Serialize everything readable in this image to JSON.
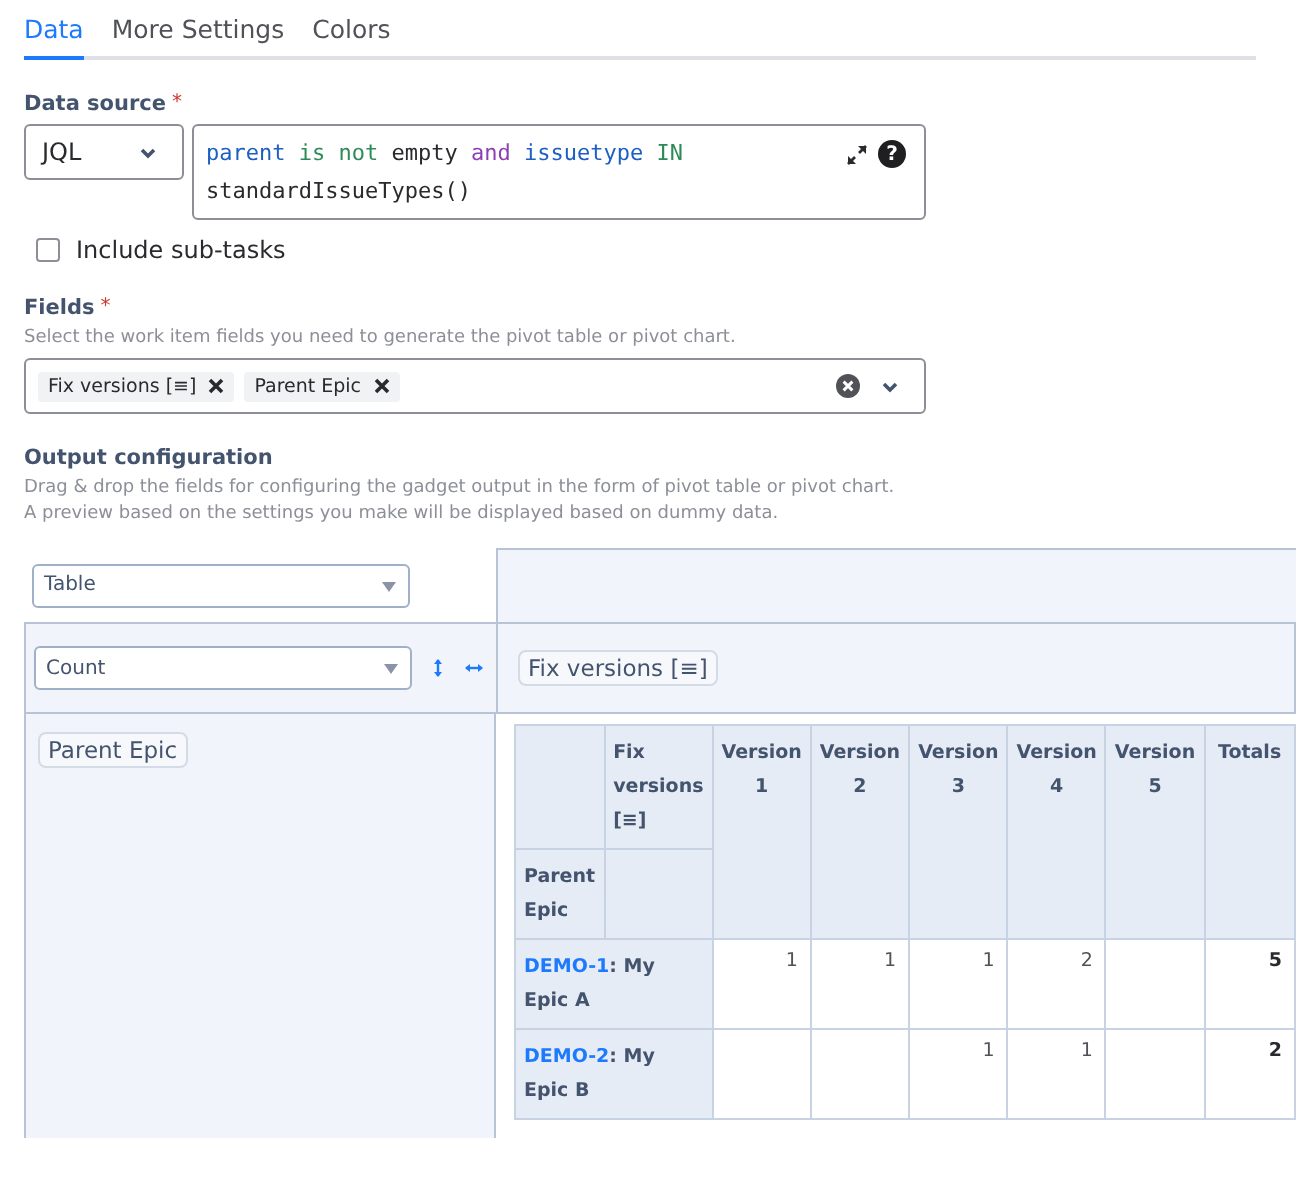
{
  "tabs": [
    {
      "label": "Data",
      "selected": true
    },
    {
      "label": "More Settings",
      "selected": false
    },
    {
      "label": "Colors",
      "selected": false
    }
  ],
  "data_source": {
    "label": "Data source",
    "required_mark": "*",
    "type_select": "JQL",
    "help_icon": "?",
    "query": [
      {
        "text": "parent",
        "kind": "field"
      },
      {
        "text": "is not",
        "kind": "operator"
      },
      {
        "text": "empty",
        "kind": "plain"
      },
      {
        "text": "and",
        "kind": "keyword"
      },
      {
        "text": "issuetype",
        "kind": "field"
      },
      {
        "text": "IN",
        "kind": "operator"
      },
      {
        "text": "standardIssueTypes()",
        "kind": "plain"
      }
    ]
  },
  "include_subtasks": {
    "label": "Include sub-tasks",
    "checked": false
  },
  "fields": {
    "label": "Fields",
    "required_mark": "*",
    "help": "Select the work item fields you need to generate the pivot table or pivot chart.",
    "chips": [
      "Fix versions [≡]",
      "Parent Epic"
    ]
  },
  "output": {
    "label": "Output configuration",
    "help": [
      "Drag & drop the fields for configuring the gadget output in the form of pivot table or pivot chart.",
      "A preview based on the settings you make will be displayed based on dummy data."
    ],
    "view_select": "Table",
    "aggregate_select": "Count",
    "column_field": "Fix versions [≡]",
    "row_field": "Parent Epic",
    "table": {
      "corner_column": "Fix versions [≡]",
      "corner_row": "Parent Epic",
      "columns": [
        "Version 1",
        "Version 2",
        "Version 3",
        "Version 4",
        "Version 5",
        "Totals"
      ],
      "rows": [
        {
          "key": "DEMO-1",
          "summary": ": My Epic A",
          "cells": [
            "1",
            "1",
            "1",
            "2",
            "",
            "5"
          ]
        },
        {
          "key": "DEMO-2",
          "summary": ": My Epic B",
          "cells": [
            "",
            "",
            "1",
            "1",
            "",
            "2"
          ]
        }
      ]
    }
  }
}
